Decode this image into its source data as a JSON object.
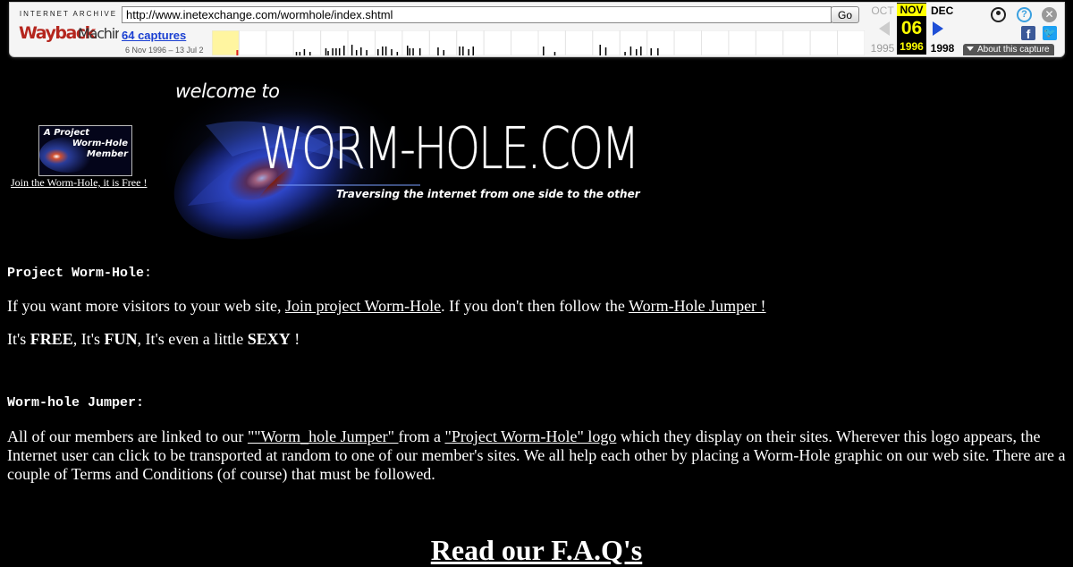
{
  "toolbar": {
    "archive_label": "INTERNET ARCHIVE",
    "logo_text": "WaybackMachine",
    "url": "http://www.inetexchange.com/wormhole/index.shtml",
    "go_label": "Go",
    "captures_label": "64 captures",
    "date_range": "6 Nov 1996 – 13 Jul 2",
    "prev_month": "OCT",
    "current_month": "NOV",
    "next_month": "DEC",
    "current_day": "06",
    "prev_year": "1995",
    "current_year": "1996",
    "next_year": "1998",
    "about_label": "About this capture",
    "sparkline_years": 24,
    "sparkline_highlight_year_index": 0,
    "sparkline_bars": [
      [
        3,
        2
      ],
      [
        3,
        5
      ],
      [
        3,
        9
      ],
      [
        3,
        14
      ],
      [
        4,
        4
      ],
      [
        4,
        6
      ],
      [
        4,
        10
      ],
      [
        4,
        13
      ],
      [
        4,
        16
      ],
      [
        4,
        20
      ],
      [
        5,
        3
      ],
      [
        5,
        7
      ],
      [
        5,
        11
      ],
      [
        5,
        16
      ],
      [
        6,
        2
      ],
      [
        6,
        6
      ],
      [
        6,
        9
      ],
      [
        6,
        14
      ],
      [
        6,
        19
      ],
      [
        7,
        4
      ],
      [
        7,
        6
      ],
      [
        7,
        9
      ],
      [
        7,
        15
      ],
      [
        8,
        7
      ],
      [
        8,
        12
      ],
      [
        9,
        2
      ],
      [
        9,
        5
      ],
      [
        9,
        10
      ],
      [
        9,
        14
      ],
      [
        12,
        4
      ],
      [
        12,
        14
      ],
      [
        14,
        6
      ],
      [
        14,
        11
      ],
      [
        15,
        4
      ],
      [
        15,
        9
      ],
      [
        15,
        14
      ],
      [
        15,
        18
      ],
      [
        16,
        3
      ],
      [
        16,
        9
      ]
    ],
    "colors": {
      "accent": "#1a3fd1",
      "current_bg": "#000000",
      "current_fg": "#ffff00"
    }
  },
  "badge": {
    "line1": "A Project",
    "line2": "Worm-Hole",
    "line3": "Member",
    "link": "Join the Worm-Hole, it is Free !"
  },
  "logo": {
    "welcome": "welcome to",
    "title": "WORM-HOLE.COM",
    "tagline": "Traversing the internet from one side to the other"
  },
  "section1": {
    "heading": "Project Worm-Hole",
    "heading_suffix": ":",
    "p1_before": "If you want more visitors to your web site, ",
    "p1_link1": "Join project Worm-Hole",
    "p1_middle": ". If you don't then follow the ",
    "p1_link2": "Worm-Hole Jumper !",
    "p2_a": "It's ",
    "p2_b": "FREE",
    "p2_c": ", It's ",
    "p2_d": "FUN",
    "p2_e": ", It's even a little ",
    "p2_f": "SEXY",
    "p2_g": " !"
  },
  "section2": {
    "heading": "Worm-hole Jumper:",
    "p_before": "All of our members are linked to our ",
    "link1": "\"\"Worm_hole Jumper\" ",
    "p_middle": " from a ",
    "link2": "\"Project Worm-Hole\"  logo",
    "p_after": " which they display on their sites. Wherever this logo appears, the Internet user can click to be transported at random to one of our member's sites. We all help each other by placing a Worm-Hole graphic on our web site. There are a couple of Terms and Conditions (of course) that must be followed."
  },
  "faq": {
    "heading": "Read our F.A.Q's"
  }
}
